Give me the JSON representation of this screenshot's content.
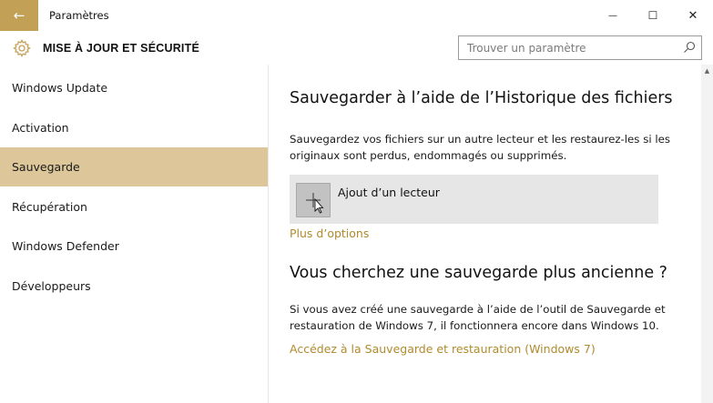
{
  "window": {
    "title": "Paramètres",
    "back_glyph": "←",
    "minimize_glyph": "—",
    "maximize_glyph": "☐",
    "close_glyph": "✕"
  },
  "header": {
    "icon": "gear-icon",
    "title": "MISE À JOUR ET SÉCURITÉ",
    "search_placeholder": "Trouver un paramètre"
  },
  "sidebar": {
    "items": [
      {
        "label": "Windows Update",
        "active": false
      },
      {
        "label": "Activation",
        "active": false
      },
      {
        "label": "Sauvegarde",
        "active": true
      },
      {
        "label": "Récupération",
        "active": false
      },
      {
        "label": "Windows Defender",
        "active": false
      },
      {
        "label": "Développeurs",
        "active": false
      }
    ]
  },
  "main": {
    "heading": "Sauvegarder à l’aide de l’Historique des fichiers",
    "description": "Sauvegardez vos fichiers sur un autre lecteur et les restaurez-les si les originaux sont perdus, endommagés ou supprimés.",
    "add_drive_label": "Ajout d’un lecteur",
    "more_options_link": "Plus d’options",
    "heading2": "Vous cherchez une sauvegarde plus ancienne ?",
    "description2": "Si vous avez créé une sauvegarde à l’aide de l’outil de Sauvegarde et restauration de Windows 7, il fonctionnera encore dans Windows 10.",
    "restore_link": "Accédez à la Sauvegarde et restauration (Windows 7)"
  },
  "colors": {
    "accent": "#c2a157",
    "active_nav": "#dcc69a",
    "link": "#b08a2e"
  }
}
